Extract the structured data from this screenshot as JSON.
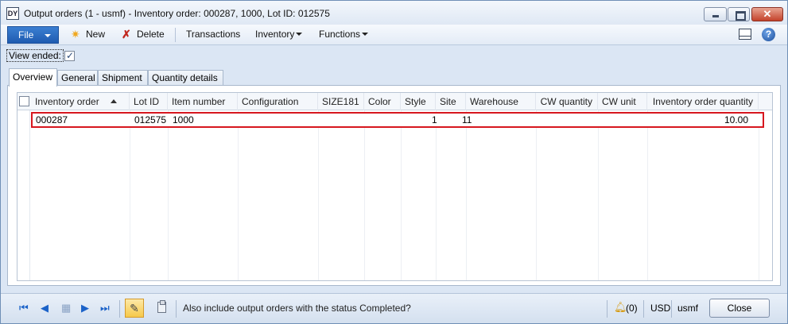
{
  "window": {
    "title": "Output orders (1 - usmf) - Inventory order: 000287, 1000, Lot ID: 012575",
    "icon_label": "DY"
  },
  "toolbar": {
    "file_label": "File",
    "new_label": "New",
    "delete_label": "Delete",
    "transactions_label": "Transactions",
    "inventory_label": "Inventory",
    "functions_label": "Functions",
    "help_label": "?"
  },
  "filter": {
    "view_ended_label": "View ended:",
    "view_ended_checked": true
  },
  "tabs": [
    {
      "label": "Overview",
      "active": true
    },
    {
      "label": "General",
      "active": false
    },
    {
      "label": "Shipment",
      "active": false
    },
    {
      "label": "Quantity details",
      "active": false
    }
  ],
  "grid": {
    "columns": [
      "Inventory order",
      "Lot ID",
      "Item number",
      "Configuration",
      "SIZE181",
      "Color",
      "Style",
      "Site",
      "Warehouse",
      "CW quantity",
      "CW unit",
      "Inventory order quantity"
    ],
    "rows": [
      {
        "inventory_order": "000287",
        "lot_id": "012575",
        "item_number": "1000",
        "configuration": "",
        "size": "",
        "color": "",
        "style": "",
        "site": "1",
        "warehouse": "11",
        "cw_quantity": "",
        "cw_unit": "",
        "inventory_order_quantity": "10.00"
      }
    ],
    "highlight_color": "#d7171f"
  },
  "statusbar": {
    "message": "Also include output orders with the status Completed?",
    "notification_count": "(0)",
    "currency": "USD",
    "company": "usmf",
    "close_label": "Close"
  }
}
